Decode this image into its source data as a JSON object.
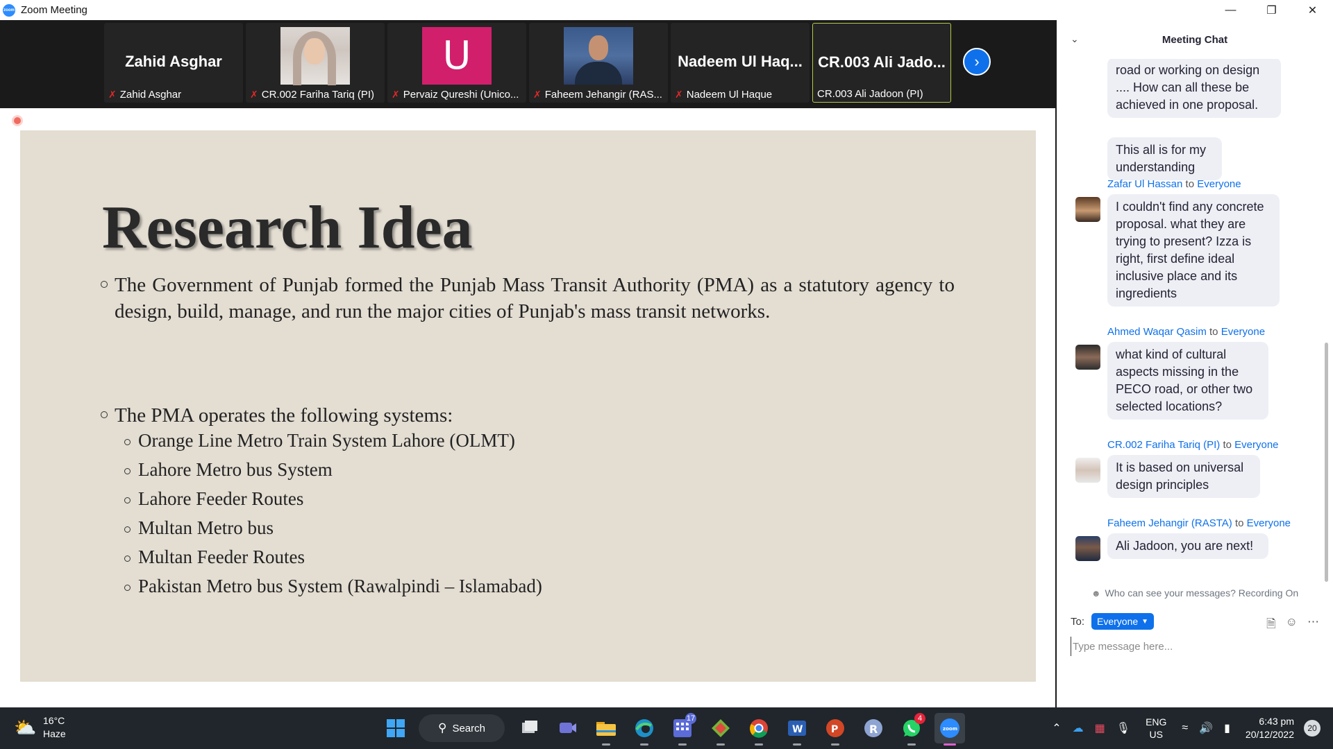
{
  "window": {
    "title": "Zoom Meeting",
    "app_icon_text": "zoom"
  },
  "gallery": {
    "tiles": [
      {
        "big_name": "Zahid Asghar",
        "label": "Zahid Asghar",
        "type": "name",
        "active": false
      },
      {
        "big_name": "",
        "label": "CR.002 Fariha Tariq (PI)",
        "type": "photo-female",
        "active": false
      },
      {
        "big_name": "U",
        "label": "Pervaiz Qureshi (Unico...",
        "type": "letter-avatar",
        "active": false
      },
      {
        "big_name": "",
        "label": "Faheem Jehangir (RAS...",
        "type": "photo-male",
        "active": false
      },
      {
        "big_name": "Nadeem Ul Haq...",
        "label": "Nadeem Ul Haque",
        "type": "name",
        "active": false
      },
      {
        "big_name": "CR.003  Ali  Jado...",
        "label": "CR.003 Ali Jadoon (PI)",
        "type": "name",
        "active": true
      }
    ],
    "avatar_letter": "U",
    "avatar_color": "#d11f6c"
  },
  "slide": {
    "title": "Research Idea",
    "bullet1": "The Government of Punjab formed the Punjab Mass Transit Authority (PMA) as a statutory agency to design, build, manage, and run the major cities of Punjab's mass transit networks.",
    "bullet2": "The PMA operates the following systems:",
    "systems": [
      "Orange Line Metro Train System Lahore (OLMT)",
      "Lahore Metro bus System",
      "Lahore Feeder Routes",
      "Multan Metro bus",
      "Multan Feeder Routes",
      "Pakistan Metro bus System (Rawalpindi – Islamabad)"
    ],
    "background": "#e3ddd2"
  },
  "chat": {
    "header": "Meeting Chat",
    "messages": [
      {
        "sender": "",
        "to": "",
        "text": "road or working on design .... How can all these be achieved in one proposal."
      },
      {
        "sender": "",
        "to": "",
        "text": "This all is for my understanding"
      },
      {
        "sender": "Zafar Ul Hassan",
        "to": "Everyone",
        "text": "I couldn't find any concrete proposal. what they are trying to present? Izza is right, first define ideal inclusive place and its ingredients"
      },
      {
        "sender": "Ahmed Waqar Qasim",
        "to": "Everyone",
        "text": "what kind of cultural aspects missing in the PECO road, or other two selected locations?"
      },
      {
        "sender": "CR.002 Fariha Tariq (PI)",
        "to": "Everyone",
        "text": "It is based on universal design principles"
      },
      {
        "sender": "Faheem Jehangir (RASTA)",
        "to": "Everyone",
        "text": "Ali Jadoon, you are next!"
      }
    ],
    "to_word": "to",
    "privacy_note": "Who can see your messages? Recording On",
    "to_label": "To:",
    "recipient": "Everyone",
    "input_placeholder": "Type message here..."
  },
  "taskbar": {
    "weather_temp": "16°C",
    "weather_desc": "Haze",
    "search_label": "Search",
    "whatsapp_badge": "4",
    "lang_line1": "ENG",
    "lang_line2": "US",
    "time": "6:43 pm",
    "date": "20/12/2022",
    "notification_count": "20",
    "calendar_badge": "17"
  },
  "colors": {
    "accent": "#0e71eb",
    "mic_muted": "#e02828",
    "active_tile_border": "#b5c94a"
  }
}
